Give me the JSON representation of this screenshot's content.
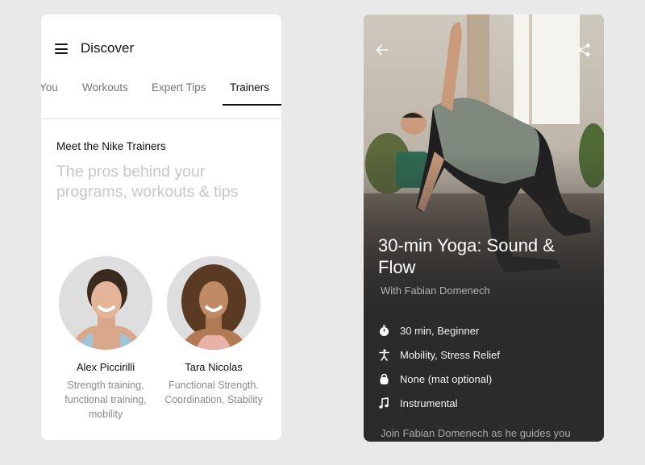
{
  "discover": {
    "title": "Discover",
    "tabs": [
      {
        "label": "You"
      },
      {
        "label": "Workouts"
      },
      {
        "label": "Expert Tips"
      },
      {
        "label": "Trainers"
      }
    ],
    "active_tab": "Trainers",
    "heading": "Meet the Nike Trainers",
    "subheading": "The pros behind your programs, workouts & tips",
    "trainers": [
      {
        "name": "Alex Piccirilli",
        "specialty": "Strength training, functional training, mobility"
      },
      {
        "name": "Tara Nicolas",
        "specialty": "Functional Strength. Coordination, Stability"
      }
    ]
  },
  "workout": {
    "title": "30-min Yoga: Sound & Flow",
    "trainer_line": "With Fabian Domenech",
    "details": [
      {
        "icon": "stopwatch-icon",
        "text": "30 min, Beginner"
      },
      {
        "icon": "person-stretch-icon",
        "text": "Mobility, Stress Relief"
      },
      {
        "icon": "kettlebell-icon",
        "text": "None (mat optional)"
      },
      {
        "icon": "music-note-icon",
        "text": "Instrumental"
      }
    ],
    "description": "Join Fabian Domenech as he guides you"
  },
  "colors": {
    "background": "#e9e9e9",
    "card_left_bg": "#ffffff",
    "card_right_bg": "#2b2b2b",
    "muted_text": "#c7c7c7",
    "active_text": "#111111"
  }
}
